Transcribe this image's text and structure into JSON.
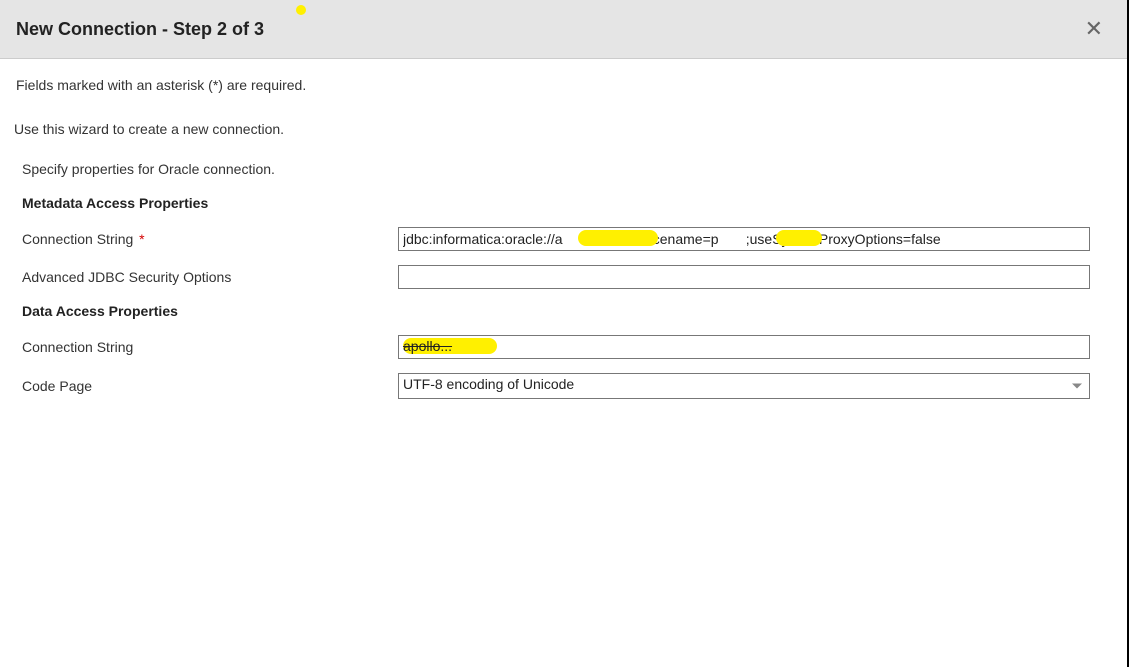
{
  "header": {
    "title": "New Connection - Step 2 of 3"
  },
  "intro": {
    "required_note": "Fields marked with an asterisk (*) are required.",
    "wizard_note": "Use this wizard to create a new connection.",
    "specify_note": "Specify properties for Oracle connection."
  },
  "sections": {
    "metadata": {
      "heading": "Metadata Access Properties",
      "fields": {
        "conn_string": {
          "label": "Connection String",
          "value": "jdbc:informatica:oracle://a              ;Servicename=p       ;useSystemProxyOptions=false",
          "required": true
        },
        "adv_jdbc": {
          "label": "Advanced JDBC Security Options",
          "value": ""
        }
      }
    },
    "data": {
      "heading": "Data Access Properties",
      "fields": {
        "conn_string2": {
          "label": "Connection String",
          "value": "",
          "obscured_hint": "apollo..."
        },
        "code_page": {
          "label": "Code Page",
          "value": "UTF-8 encoding of Unicode"
        }
      }
    }
  }
}
